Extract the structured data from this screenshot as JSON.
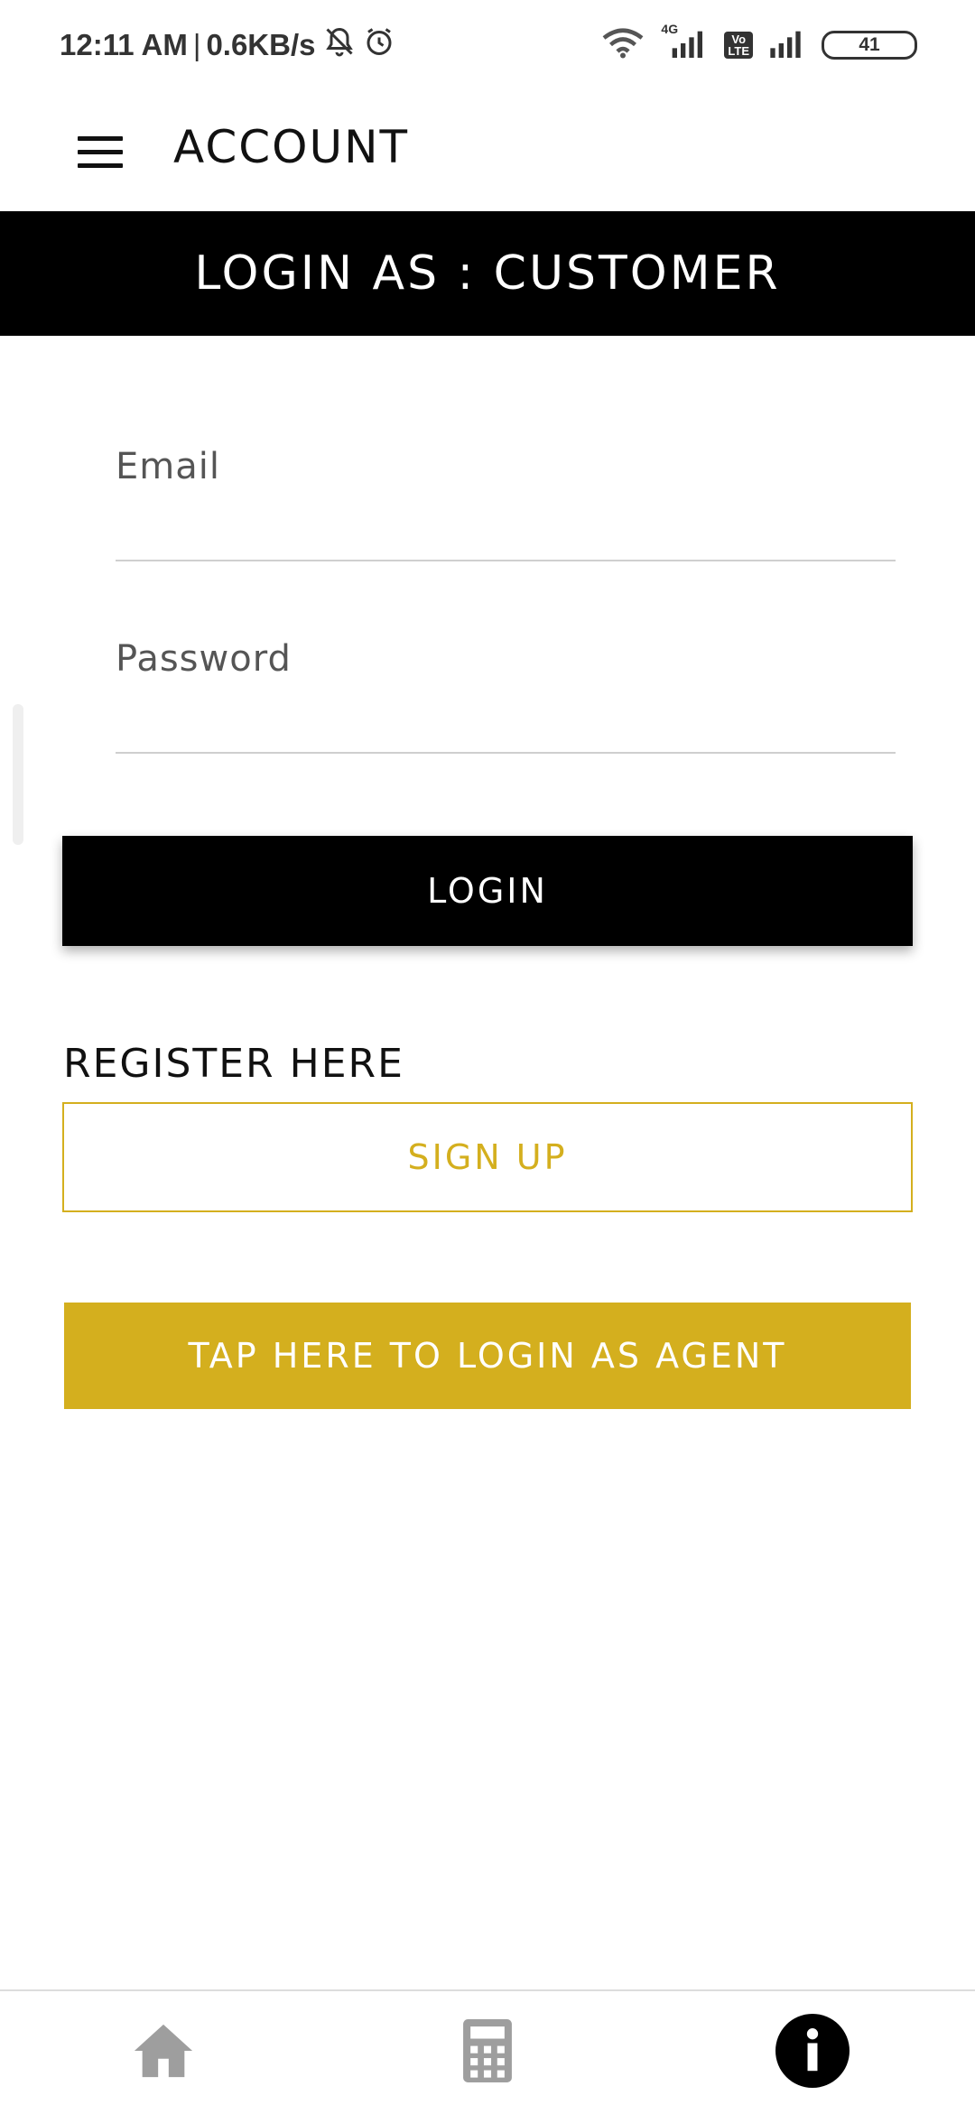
{
  "status_bar": {
    "time": "12:11 AM",
    "separator": "|",
    "speed": "0.6KB/s",
    "network_label": "4G",
    "volte_label": "Vo\nLTE",
    "battery": "41"
  },
  "app_bar": {
    "title": "ACCOUNT"
  },
  "banner": {
    "text": "LOGIN AS : CUSTOMER"
  },
  "form": {
    "email_label": "Email",
    "email_value": "",
    "password_label": "Password",
    "password_value": ""
  },
  "buttons": {
    "login": "LOGIN",
    "register_label": "REGISTER HERE",
    "signup": "SIGN UP",
    "agent": "TAP HERE TO LOGIN AS AGENT"
  },
  "bottom_nav": {
    "items": [
      {
        "icon": "home-icon"
      },
      {
        "icon": "calculator-icon"
      },
      {
        "icon": "info-icon",
        "active": true
      }
    ]
  },
  "colors": {
    "accent_gold": "#d4af1e",
    "primary_black": "#000000",
    "background": "#ffffff",
    "nav_inactive": "#9e9e9e"
  }
}
